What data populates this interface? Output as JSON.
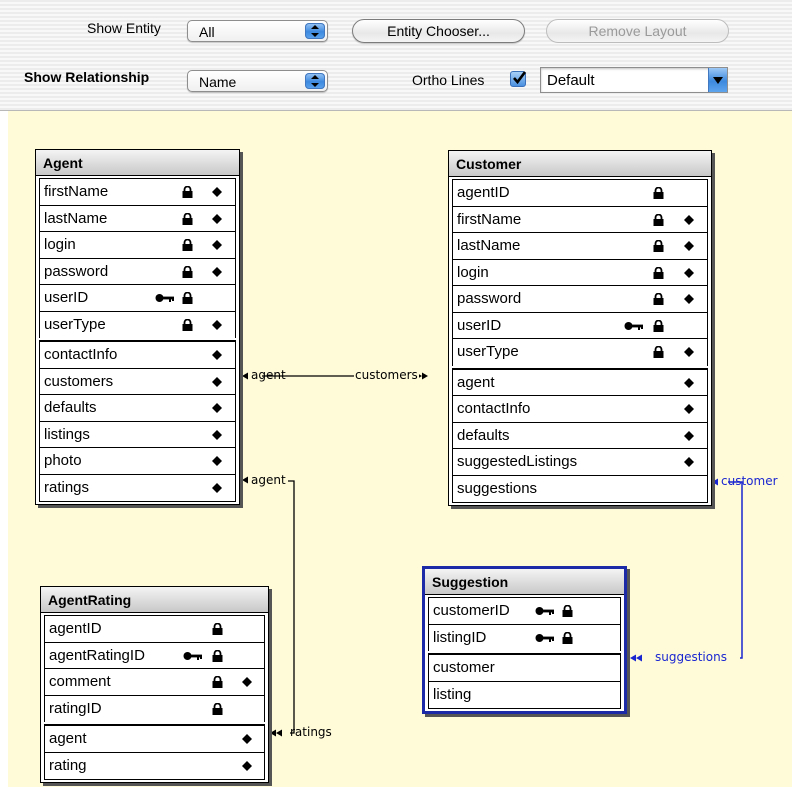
{
  "toolbar": {
    "show_entity_label": "Show Entity",
    "show_entity_value": "All",
    "entity_chooser_label": "Entity Chooser...",
    "remove_layout_label": "Remove Layout",
    "show_relationship_label": "Show Relationship",
    "show_relationship_value": "Name",
    "ortho_lines_label": "Ortho Lines",
    "ortho_lines_checked": true,
    "layout_value": "Default"
  },
  "colors": {
    "canvas_bg": "#fffbd9",
    "relationship_line": "#000000",
    "selected_relationship": "#1a26d0",
    "selected_entity_border": "#1c2aa8"
  },
  "legend_icons": {
    "key": "primary-key-icon",
    "lock": "locked-icon",
    "diamond": "class-property-icon"
  },
  "entities": {
    "agent": {
      "name": "Agent",
      "attributes": [
        {
          "name": "firstName",
          "key": false,
          "lock": true,
          "diamond": true
        },
        {
          "name": "lastName",
          "key": false,
          "lock": true,
          "diamond": true
        },
        {
          "name": "login",
          "key": false,
          "lock": true,
          "diamond": true
        },
        {
          "name": "password",
          "key": false,
          "lock": true,
          "diamond": true
        },
        {
          "name": "userID",
          "key": true,
          "lock": true,
          "diamond": false
        },
        {
          "name": "userType",
          "key": false,
          "lock": true,
          "diamond": true
        }
      ],
      "relationships": [
        {
          "name": "contactInfo",
          "diamond": true
        },
        {
          "name": "customers",
          "diamond": true
        },
        {
          "name": "defaults",
          "diamond": true
        },
        {
          "name": "listings",
          "diamond": true
        },
        {
          "name": "photo",
          "diamond": true
        },
        {
          "name": "ratings",
          "diamond": true
        }
      ]
    },
    "customer": {
      "name": "Customer",
      "attributes": [
        {
          "name": "agentID",
          "key": false,
          "lock": true,
          "diamond": false
        },
        {
          "name": "firstName",
          "key": false,
          "lock": true,
          "diamond": true
        },
        {
          "name": "lastName",
          "key": false,
          "lock": true,
          "diamond": true
        },
        {
          "name": "login",
          "key": false,
          "lock": true,
          "diamond": true
        },
        {
          "name": "password",
          "key": false,
          "lock": true,
          "diamond": true
        },
        {
          "name": "userID",
          "key": true,
          "lock": true,
          "diamond": false
        },
        {
          "name": "userType",
          "key": false,
          "lock": true,
          "diamond": true
        }
      ],
      "relationships": [
        {
          "name": "agent",
          "diamond": true
        },
        {
          "name": "contactInfo",
          "diamond": true
        },
        {
          "name": "defaults",
          "diamond": true
        },
        {
          "name": "suggestedListings",
          "diamond": true
        },
        {
          "name": "suggestions",
          "diamond": false
        }
      ]
    },
    "agentrating": {
      "name": "AgentRating",
      "attributes": [
        {
          "name": "agentID",
          "key": false,
          "lock": true,
          "diamond": false
        },
        {
          "name": "agentRatingID",
          "key": true,
          "lock": true,
          "diamond": false
        },
        {
          "name": "comment",
          "key": false,
          "lock": true,
          "diamond": true
        },
        {
          "name": "ratingID",
          "key": false,
          "lock": true,
          "diamond": false
        }
      ],
      "relationships": [
        {
          "name": "agent",
          "diamond": true
        },
        {
          "name": "rating",
          "diamond": true
        }
      ]
    },
    "suggestion": {
      "name": "Suggestion",
      "attributes": [
        {
          "name": "customerID",
          "key": true,
          "lock": true,
          "diamond": false
        },
        {
          "name": "listingID",
          "key": true,
          "lock": true,
          "diamond": false
        }
      ],
      "relationships": [
        {
          "name": "customer",
          "diamond": false
        },
        {
          "name": "listing",
          "diamond": false
        }
      ]
    }
  },
  "relationship_labels": {
    "agent_customers_left": "agent",
    "agent_customers_right": "customers",
    "ratings_agent": "agent",
    "ratings_ratings": "ratings",
    "suggestion_customer": "customer",
    "suggestion_suggestions": "suggestions"
  }
}
